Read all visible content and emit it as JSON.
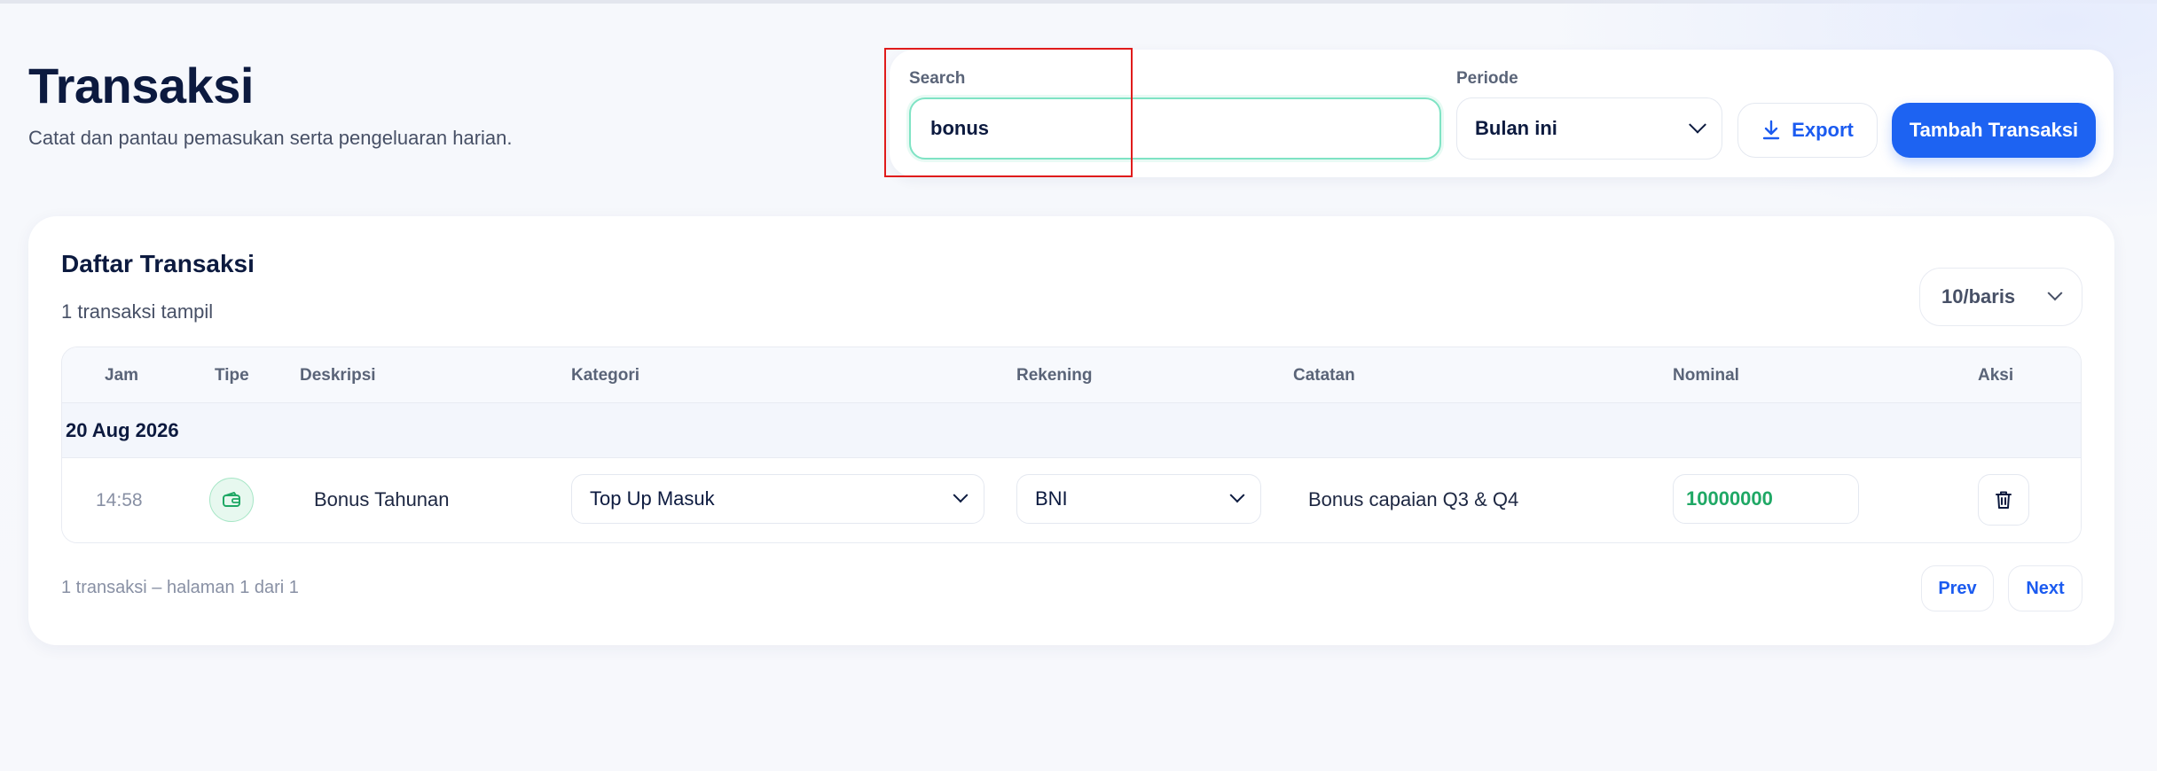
{
  "header": {
    "title": "Transaksi",
    "subtitle": "Catat dan pantau pemasukan serta pengeluaran harian."
  },
  "filters": {
    "search_label": "Search",
    "search_value": "bonus",
    "period_label": "Periode",
    "period_value": "Bulan ini",
    "export_label": "Export",
    "add_label": "Tambah Transaksi"
  },
  "list": {
    "title": "Daftar Transaksi",
    "count_text": "1 transaksi tampil",
    "rows_per_page": "10/baris",
    "columns": [
      "Jam",
      "Tipe",
      "Deskripsi",
      "Kategori",
      "Rekening",
      "Catatan",
      "Nominal",
      "Aksi"
    ],
    "groups": [
      {
        "date": "20 Aug 2026",
        "rows": [
          {
            "time": "14:58",
            "type_icon": "wallet-icon",
            "description": "Bonus Tahunan",
            "category": "Top Up Masuk",
            "account": "BNI",
            "note": "Bonus capaian Q3 & Q4",
            "amount": "10000000"
          }
        ]
      }
    ],
    "footer_text": "1 transaksi – halaman 1 dari 1",
    "prev_label": "Prev",
    "next_label": "Next"
  },
  "colors": {
    "primary": "#1d63f2",
    "income_green": "#1fa865",
    "highlight": "#e01b1b"
  }
}
